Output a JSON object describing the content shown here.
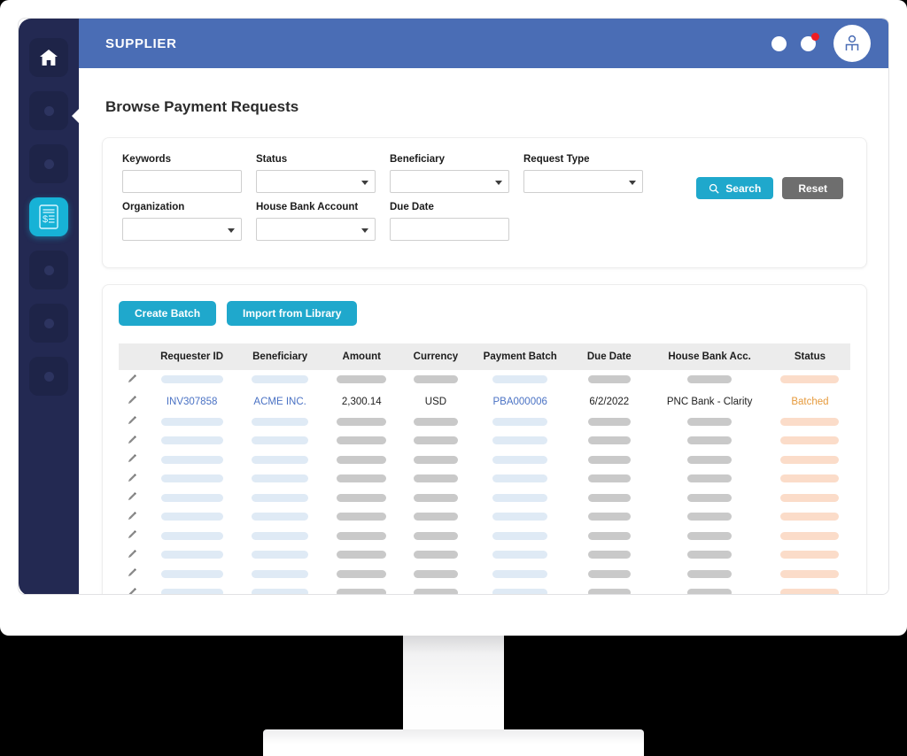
{
  "app": {
    "title": "SUPPLIER",
    "page_title": "Browse Payment Requests"
  },
  "topbar": {
    "icon1": "circle-icon",
    "icon2": "notification-circle-icon",
    "avatar": "user-avatar-icon"
  },
  "sidebar": {
    "items": [
      {
        "name": "home",
        "icon": "home-icon",
        "active": false
      },
      {
        "name": "item-2",
        "icon": "dot-icon",
        "active": false
      },
      {
        "name": "item-3",
        "icon": "dot-icon",
        "active": false
      },
      {
        "name": "payment-requests",
        "icon": "invoice-document-icon",
        "active": true
      },
      {
        "name": "item-5",
        "icon": "dot-icon",
        "active": false
      },
      {
        "name": "item-6",
        "icon": "dot-icon",
        "active": false
      },
      {
        "name": "item-7",
        "icon": "dot-icon",
        "active": false
      }
    ]
  },
  "filters": {
    "keywords": {
      "label": "Keywords",
      "value": "",
      "type": "text"
    },
    "status": {
      "label": "Status",
      "value": "",
      "type": "select"
    },
    "beneficiary": {
      "label": "Beneficiary",
      "value": "",
      "type": "select"
    },
    "request_type": {
      "label": "Request Type",
      "value": "",
      "type": "select"
    },
    "organization": {
      "label": "Organization",
      "value": "",
      "type": "select"
    },
    "house_bank_account": {
      "label": "House Bank Account",
      "value": "",
      "type": "select"
    },
    "due_date": {
      "label": "Due Date",
      "value": "",
      "type": "text"
    },
    "search_label": "Search",
    "reset_label": "Reset"
  },
  "toolbar": {
    "create_batch_label": "Create Batch",
    "import_library_label": "Import from Library"
  },
  "table": {
    "columns": [
      "Requester ID",
      "Beneficiary",
      "Amount",
      "Currency",
      "Payment Batch",
      "Due Date",
      "House Bank Acc.",
      "Status"
    ],
    "data_row": {
      "requester_id": "INV307858",
      "beneficiary": "ACME INC.",
      "amount": "2,300.14",
      "currency": "USD",
      "payment_batch": "PBA000006",
      "due_date": "6/2/2022",
      "house_bank_acc": "PNC Bank - Clarity",
      "status": "Batched"
    },
    "data_row_index": 1,
    "total_rows": 12,
    "skeleton_note": "placeholder bars"
  },
  "colors": {
    "topbar": "#4a6db5",
    "sidebar": "#232952",
    "accent_cyan": "#1fa8cc",
    "reset_gray": "#6e6e6e",
    "link_blue": "#4a72c4",
    "status_orange": "#e69a3c",
    "badge_red": "#ed1c24"
  }
}
